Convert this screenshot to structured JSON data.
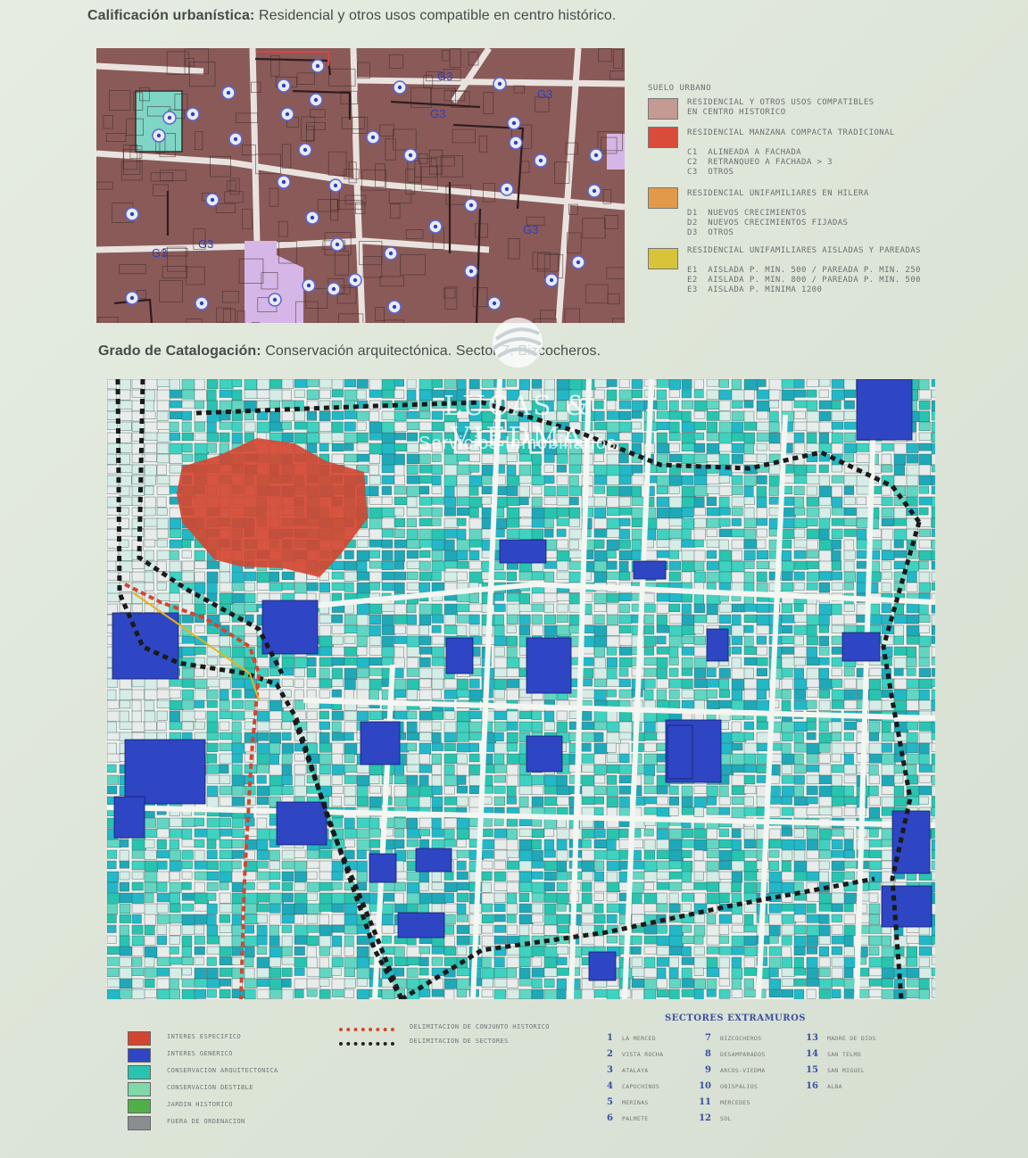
{
  "headings": {
    "top": {
      "label": "Calificación urbanística:",
      "text": " Residencial y otros usos compatible en centro histórico."
    },
    "middle": {
      "label": "Grado de Catalogación:",
      "text": " Conservación arquitectónica. Sector 7. Bizcocheros."
    }
  },
  "map1": {
    "block_labels": [
      "G3",
      "G3",
      "G3",
      "G3",
      "G3",
      "G3"
    ],
    "colors": {
      "residential": "#8a5a58",
      "green_zone": "#7fd6c4",
      "lilac_zone": "#d6b6e6",
      "street": "#e9e3df"
    }
  },
  "legend1": {
    "title": "SUELO URBANO",
    "items": [
      {
        "color": "#c49a92",
        "text": "RESIDENCIAL Y OTROS USOS COMPATIBLES\nEN CENTRO HISTORICO"
      },
      {
        "color": "#d94b3a",
        "text": "RESIDENCIAL MANZANA COMPACTA TRADICIONAL\n\nC1  ALINEADA A FACHADA\nC2  RETRANQUEO A FACHADA > 3\nC3  OTROS"
      },
      {
        "color": "#e29a4a",
        "text": "RESIDENCIAL UNIFAMILIARES EN HILERA\n\nD1  NUEVOS CRECIMIENTOS\nD2  NUEVOS CRECIMIENTOS FIJADAS\nD3  OTROS"
      },
      {
        "color": "#d8c43a",
        "text": "RESIDENCIAL UNIFAMILIARES AISLADAS Y PAREADAS\n\nE1  AISLADA P. MIN. 500 / PAREADA P. MIN. 250\nE2  AISLADA P. MIN. 800 / PAREADA P. MIN. 500\nE3  AISLADA P. MINIMA 1200"
      }
    ]
  },
  "watermark": {
    "name": "LUCAS & VIEDMA",
    "subtitle": "Servicios Inmobiliarios"
  },
  "legend2": {
    "items": [
      {
        "color": "#d4452f",
        "text": "INTERES ESPECIFICO"
      },
      {
        "color": "#2e45c4",
        "text": "INTERES GENERICO"
      },
      {
        "color": "#28c4b0",
        "text": "CONSERVACION ARQUITECTONICA"
      },
      {
        "color": "#7fd8a8",
        "text": "CONSERVACION DESTIBLE"
      },
      {
        "color": "#4fb04a",
        "text": "JARDIN HISTORICO"
      },
      {
        "color": "#8a8e90",
        "text": "FUERA DE ORDENACION"
      }
    ],
    "lines": [
      {
        "color": "#d4452f",
        "text": "DELIMITACION DE CONJUNTO HISTORICO"
      },
      {
        "color": "#222222",
        "text": "DELIMITACION DE SECTORES"
      }
    ],
    "sectors_title": "SECTORES EXTRAMUROS",
    "sectors": [
      {
        "n": "1",
        "name": "LA MERCED"
      },
      {
        "n": "2",
        "name": "VISTA ROCHA"
      },
      {
        "n": "3",
        "name": "ATALAYA"
      },
      {
        "n": "4",
        "name": "CAPUCHINOS"
      },
      {
        "n": "5",
        "name": "MERINAS"
      },
      {
        "n": "6",
        "name": "PALMETE"
      },
      {
        "n": "7",
        "name": "BIZCOCHEROS"
      },
      {
        "n": "8",
        "name": "DESAMPARADOS"
      },
      {
        "n": "9",
        "name": "ARCOS-VIEDMA"
      },
      {
        "n": "10",
        "name": "OBISPALIOS"
      },
      {
        "n": "11",
        "name": "MERCEDES"
      },
      {
        "n": "12",
        "name": "SOL"
      },
      {
        "n": "13",
        "name": "MADRE DE DIOS"
      },
      {
        "n": "14",
        "name": "SAN TELMO"
      },
      {
        "n": "15",
        "name": "SAN MIGUEL"
      },
      {
        "n": "16",
        "name": "ALBA"
      }
    ]
  }
}
